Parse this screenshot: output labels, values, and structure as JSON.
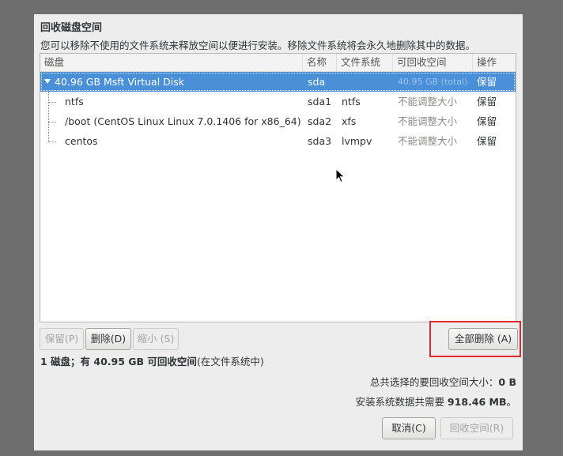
{
  "dialog": {
    "title": "回收磁盘空间",
    "description": "您可以移除不使用的文件系统来释放空间以便进行安装。移除文件系统将会永久地删除其中的数据。"
  },
  "tree": {
    "columns": [
      "磁盘",
      "名称",
      "文件系统",
      "可回收空间",
      "操作"
    ],
    "rows": [
      {
        "disk": "40.96 GB Msft Virtual Disk",
        "name": "sda",
        "fs": "",
        "reclaimable": "40.95 GB (total)",
        "action": "保留"
      },
      {
        "disk": "ntfs",
        "name": "sda1",
        "fs": "ntfs",
        "reclaimable": "不能调整大小",
        "action": "保留"
      },
      {
        "disk": "/boot (CentOS Linux Linux 7.0.1406 for x86_64)",
        "name": "sda2",
        "fs": "xfs",
        "reclaimable": "不能调整大小",
        "action": "保留"
      },
      {
        "disk": "centos",
        "name": "sda3",
        "fs": "lvmpv",
        "reclaimable": "不能调整大小",
        "action": "保留"
      }
    ]
  },
  "buttons": {
    "preserve": "保留(P)",
    "delete": "删除(D)",
    "shrink": "缩小 (S)",
    "delete_all": "全部删除 (A)",
    "cancel": "取消(C)",
    "reclaim": "回收空间(R)"
  },
  "summary": {
    "prefix": "1 磁盘；有 40.95 GB 可回收空间",
    "suffix": "(在文件系统中)"
  },
  "totals": {
    "selected_reclaim": "总共选择的要回收空间大小：",
    "selected_reclaim_value": "0 B",
    "install_needs": "安装系统数据共需要 ",
    "install_needs_value": "918.46 MB",
    "install_needs_end": "。"
  },
  "colors": {
    "selection": "#4a90d9",
    "highlight": "#e02a2a"
  }
}
